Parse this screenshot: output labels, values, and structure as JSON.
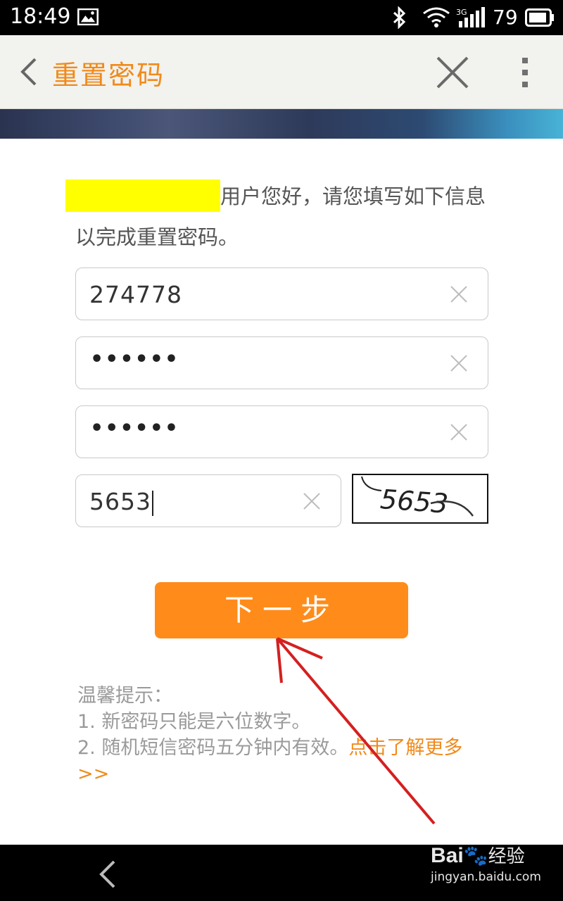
{
  "status_bar": {
    "time": "18:49",
    "network": "3G",
    "battery": "79",
    "icons": [
      "image-icon",
      "bluetooth-icon",
      "wifi-icon",
      "signal-icon",
      "battery-icon"
    ]
  },
  "header": {
    "title": "重置密码"
  },
  "greeting": {
    "text": "用户您好，请您填写如下信息以完成重置密码。"
  },
  "form": {
    "fields": [
      {
        "value": "274778"
      },
      {
        "value": "••••••"
      },
      {
        "value": "••••••"
      },
      {
        "value": "5653"
      }
    ],
    "captcha_text": "5653"
  },
  "buttons": {
    "next": "下一步"
  },
  "tips": {
    "title": "温馨提示：",
    "line1": "1. 新密码只能是六位数字。",
    "line2": "2. 随机短信密码五分钟内有效。",
    "link": "点击了解更多>>"
  },
  "watermark": {
    "brand": "Bai",
    "brand_cn": "经验",
    "url": "jingyan.baidu.com"
  },
  "colors": {
    "accent": "#f08a1c",
    "button": "#ff8c1a",
    "highlight": "#ffff00",
    "arrow": "#d42020"
  }
}
